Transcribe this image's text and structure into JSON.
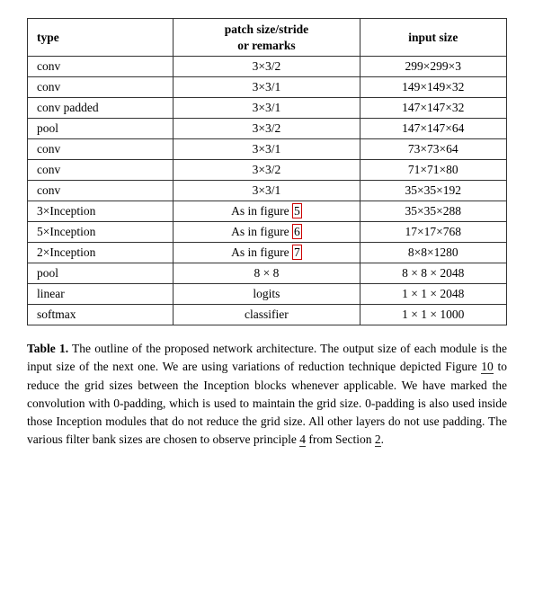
{
  "table": {
    "headers": {
      "col1": "type",
      "col2_line1": "patch size/stride",
      "col2_line2": "or remarks",
      "col3": "input size"
    },
    "rows": [
      {
        "type": "conv",
        "patch": "3×3/2",
        "input": "299×299×3"
      },
      {
        "type": "conv",
        "patch": "3×3/1",
        "input": "149×149×32"
      },
      {
        "type": "conv padded",
        "patch": "3×3/1",
        "input": "147×147×32"
      },
      {
        "type": "pool",
        "patch": "3×3/2",
        "input": "147×147×64"
      },
      {
        "type": "conv",
        "patch": "3×3/1",
        "input": "73×73×64"
      },
      {
        "type": "conv",
        "patch": "3×3/2",
        "input": "71×71×80"
      },
      {
        "type": "conv",
        "patch": "3×3/1",
        "input": "35×35×192"
      },
      {
        "type": "3×Inception",
        "patch": "As in figure 5",
        "input": "35×35×288",
        "fig_num": "5",
        "bordered": true
      },
      {
        "type": "5×Inception",
        "patch": "As in figure 6",
        "input": "17×17×768",
        "fig_num": "6",
        "bordered": true
      },
      {
        "type": "2×Inception",
        "patch": "As in figure 7",
        "input": "8×8×1280",
        "fig_num": "7",
        "bordered": true
      },
      {
        "type": "pool",
        "patch": "8 × 8",
        "input": "8 × 8 × 2048"
      },
      {
        "type": "linear",
        "patch": "logits",
        "input": "1 × 1 × 2048"
      },
      {
        "type": "softmax",
        "patch": "classifier",
        "input": "1 × 1 × 1000"
      }
    ]
  },
  "caption": {
    "label": "Table 1.",
    "text": " The outline of the proposed network architecture.  The output size of each module is the input size of the next one.  We are using variations of reduction technique depicted Figure ",
    "link1": "10",
    "text2": " to reduce the grid sizes between the Inception blocks whenever applicable. We have marked the convolution with 0-padding, which is used to maintain the grid size.  0-padding is also used inside those Inception modules that do not reduce the grid size. All other layers do not use padding. The various filter bank sizes are chosen to observe principle ",
    "link2": "4",
    "text3": " from Section ",
    "link3": "2",
    "text4": "."
  }
}
